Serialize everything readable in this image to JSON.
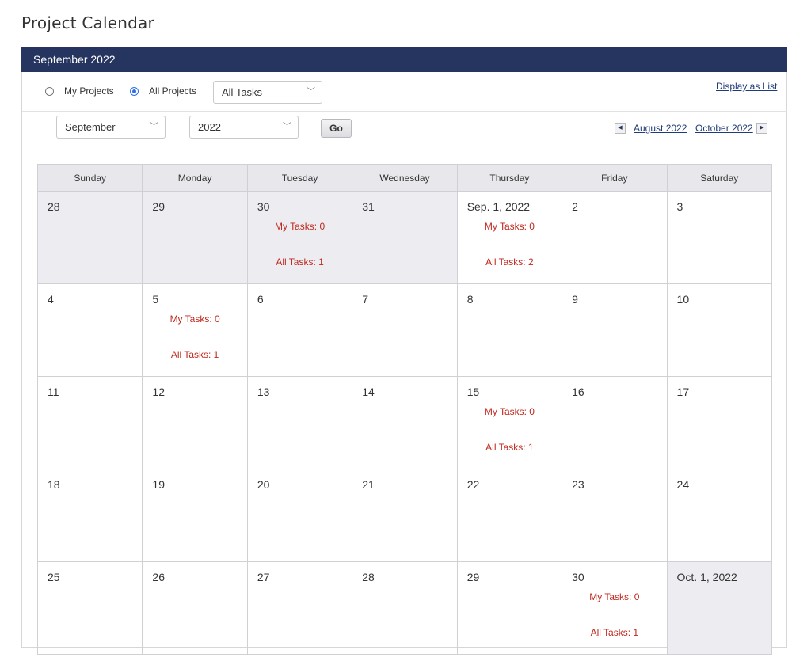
{
  "page_title": "Project Calendar",
  "panel_title": "September 2022",
  "filters": {
    "my_projects_label": "My Projects",
    "all_projects_label": "All Projects",
    "selected_scope": "All Projects",
    "task_filter_value": "All Tasks",
    "display_as_list": "Display as List"
  },
  "nav": {
    "month_value": "September",
    "year_value": "2022",
    "go_label": "Go",
    "prev_month": "August 2022",
    "next_month": "October 2022"
  },
  "weekdays": [
    "Sunday",
    "Monday",
    "Tuesday",
    "Wednesday",
    "Thursday",
    "Friday",
    "Saturday"
  ],
  "weeks": [
    [
      {
        "label": "28",
        "other": true
      },
      {
        "label": "29",
        "other": true
      },
      {
        "label": "30",
        "other": true,
        "my": "My Tasks: 0",
        "all": "All Tasks: 1"
      },
      {
        "label": "31",
        "other": true
      },
      {
        "label": "Sep. 1, 2022",
        "my": "My Tasks: 0",
        "all": "All Tasks: 2"
      },
      {
        "label": "2"
      },
      {
        "label": "3"
      }
    ],
    [
      {
        "label": "4"
      },
      {
        "label": "5",
        "my": "My Tasks: 0",
        "all": "All Tasks: 1"
      },
      {
        "label": "6"
      },
      {
        "label": "7"
      },
      {
        "label": "8"
      },
      {
        "label": "9"
      },
      {
        "label": "10"
      }
    ],
    [
      {
        "label": "11"
      },
      {
        "label": "12"
      },
      {
        "label": "13"
      },
      {
        "label": "14"
      },
      {
        "label": "15",
        "my": "My Tasks: 0",
        "all": "All Tasks: 1"
      },
      {
        "label": "16"
      },
      {
        "label": "17"
      }
    ],
    [
      {
        "label": "18"
      },
      {
        "label": "19"
      },
      {
        "label": "20"
      },
      {
        "label": "21"
      },
      {
        "label": "22"
      },
      {
        "label": "23"
      },
      {
        "label": "24"
      }
    ],
    [
      {
        "label": "25"
      },
      {
        "label": "26"
      },
      {
        "label": "27"
      },
      {
        "label": "28"
      },
      {
        "label": "29"
      },
      {
        "label": "30",
        "my": "My Tasks: 0",
        "all": "All Tasks: 1"
      },
      {
        "label": "Oct. 1, 2022",
        "other": true
      }
    ]
  ],
  "colors": {
    "header_bg": "#253560",
    "task_text": "#c0281e",
    "link": "#1f3b7a",
    "other_month_bg": "#ededf1"
  }
}
